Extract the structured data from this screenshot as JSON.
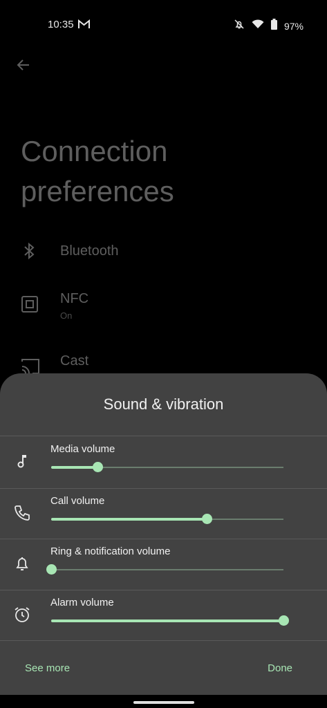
{
  "status_bar": {
    "time": "10:35",
    "battery": "97%",
    "icons": [
      "gmail-icon",
      "notifications-off-icon",
      "wifi-icon",
      "battery-icon"
    ]
  },
  "background_page": {
    "title": "Connection preferences",
    "items": [
      {
        "label": "Bluetooth",
        "sub": "",
        "icon": "bluetooth-icon"
      },
      {
        "label": "NFC",
        "sub": "On",
        "icon": "nfc-icon"
      },
      {
        "label": "Cast",
        "sub": "",
        "icon": "cast-icon"
      }
    ]
  },
  "sheet": {
    "title": "Sound & vibration",
    "volumes": [
      {
        "label": "Media volume",
        "icon": "music-note-icon",
        "level": 0.2
      },
      {
        "label": "Call volume",
        "icon": "phone-icon",
        "level": 0.67
      },
      {
        "label": "Ring & notification volume",
        "icon": "bell-icon",
        "level": 0.0
      },
      {
        "label": "Alarm volume",
        "icon": "alarm-icon",
        "level": 1.0
      }
    ],
    "see_more": "See more",
    "done": "Done"
  },
  "colors": {
    "accent": "#a8e6b4",
    "sheet_bg": "#424242",
    "dim_text": "#5e5e5e"
  }
}
